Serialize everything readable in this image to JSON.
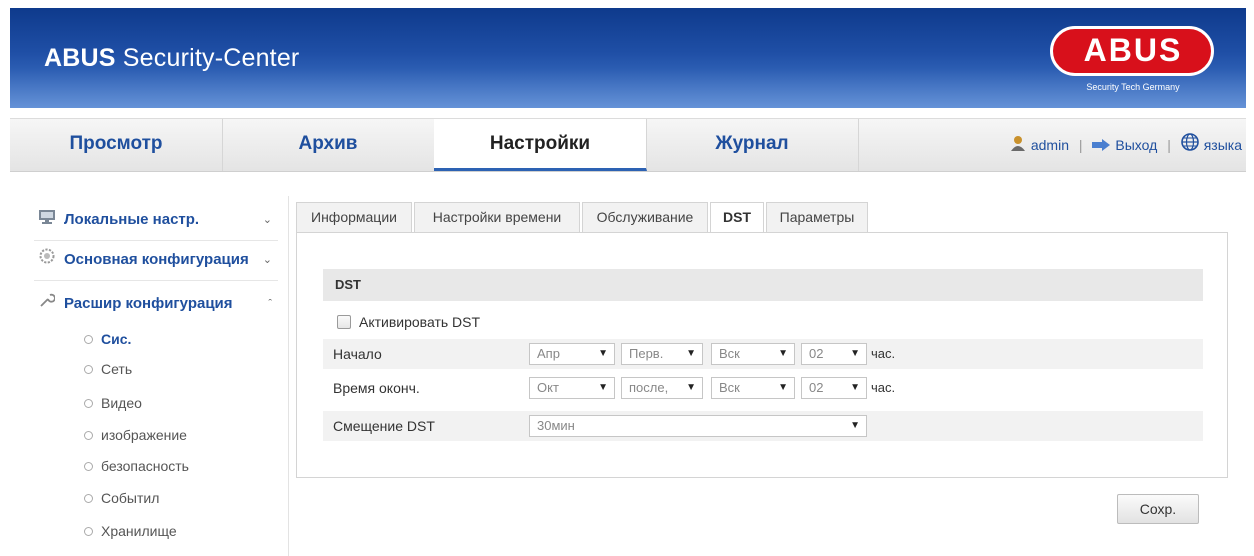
{
  "header": {
    "title_bold": "ABUS",
    "title_rest": " Security-Center",
    "logo_text": "ABUS",
    "logo_tagline": "Security Tech Germany",
    "brand_color": "#d8101b"
  },
  "topnav": {
    "tabs": [
      {
        "label": "Просмотр"
      },
      {
        "label": "Архив"
      },
      {
        "label": "Настройки"
      },
      {
        "label": "Журнал"
      }
    ],
    "active_tab": "Настройки",
    "user": "admin",
    "logout": "Выход",
    "language": "языка"
  },
  "sidebar": {
    "sections": [
      {
        "label": "Локальные настр.",
        "icon": "monitor-icon"
      },
      {
        "label": "Основная конфигурация",
        "icon": "gear-icon"
      },
      {
        "label": "Расшир конфигурация",
        "icon": "wrench-icon"
      }
    ],
    "items": [
      {
        "label": "Сис."
      },
      {
        "label": "Сеть"
      },
      {
        "label": "Видео"
      },
      {
        "label": "изображение"
      },
      {
        "label": "безопасность"
      },
      {
        "label": "Событил"
      },
      {
        "label": "Хранилище"
      }
    ],
    "active_item": "Сис."
  },
  "tabs": [
    {
      "label": "Информации"
    },
    {
      "label": "Настройки времени"
    },
    {
      "label": "Обслуживание"
    },
    {
      "label": "DST"
    },
    {
      "label": "Параметры"
    }
  ],
  "active_tab": "DST",
  "dst": {
    "section_title": "DST",
    "enable_label": "Активировать DST",
    "enable_checked": false,
    "start": {
      "label": "Начало",
      "month": "Апр",
      "week": "Перв.",
      "day": "Вск",
      "hour": "02",
      "unit": "час."
    },
    "end": {
      "label": "Время оконч.",
      "month": "Окт",
      "week": "после,",
      "day": "Вск",
      "hour": "02",
      "unit": "час."
    },
    "offset": {
      "label": "Смещение DST",
      "value": "30мин"
    }
  },
  "save_label": "Сохр."
}
